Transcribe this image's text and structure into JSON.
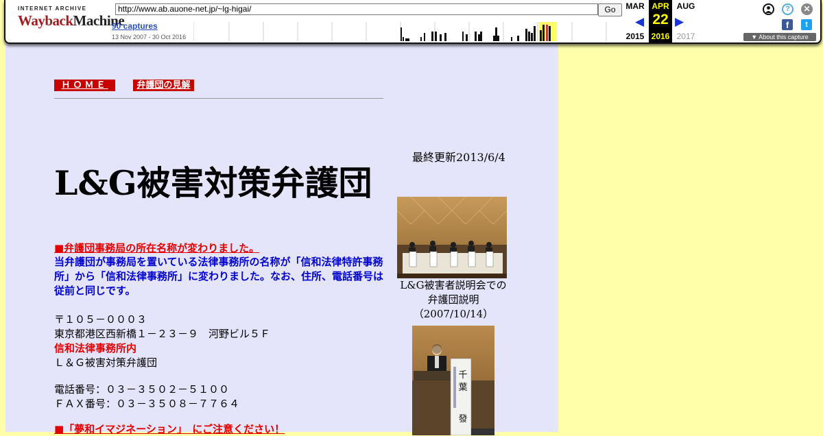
{
  "wayback": {
    "logo_top": "INTERNET ARCHIVE",
    "logo_main_a": "Wayback",
    "logo_main_b": "Machine",
    "url": "http://www.ab.auone-net.jp/~lg-higai/",
    "go_label": "Go",
    "captures": "90 captures",
    "range": "13 Nov 2007 - 30 Oct 2016",
    "prev_month": "MAR",
    "prev_year": "2015",
    "cur_month": "APR",
    "cur_day": "22",
    "cur_year": "2016",
    "next_month": "AUG",
    "next_year": "2017",
    "about": "About this capture",
    "icons": [
      "user-icon",
      "help-icon",
      "close-icon",
      "facebook-icon",
      "twitter-icon",
      "arrow-left-icon",
      "arrow-right-icon"
    ]
  },
  "nav": {
    "home": "ＨＯＭＥ",
    "opinion": "弁護団の見解"
  },
  "page": {
    "updated": "最終更新2013/6/4",
    "title": "L&G被害対策弁護団",
    "notice_heading": "■弁護団事務局の所在名称が変わりました。",
    "notice_body": "当弁護団が事務局を置いている法律事務所の名称が「信和法律特許事務所」から「信和法律事務所」に変わりました。なお、住所、電話番号は従前と同じです。",
    "postal": "〒１０５－０００３",
    "address": "東京都港区西新橋１－２３－９　河野ビル５Ｆ",
    "firm": "信和法律事務所内",
    "org": "Ｌ＆Ｇ被害対策弁護団",
    "tel": "電話番号：０３－３５０２－５１００",
    "fax": "ＦＡＸ番号：０３－３５０８－７７６４",
    "warning_heading": "■「夢和イマジネーション」　にご注意ください！",
    "photo1_caption_l1": "L&G被害者説明会での",
    "photo1_caption_l2": "弁護団説明",
    "photo1_caption_l3": "（2007/10/14）"
  },
  "colors": {
    "background": "#ffffaa",
    "panel": "#e4e4fb",
    "nav_red": "#c80000",
    "notice_blue": "#0000d0",
    "alert_red": "#e50000",
    "current_date_bg": "#000000",
    "current_date_fg": "#ffff00"
  }
}
